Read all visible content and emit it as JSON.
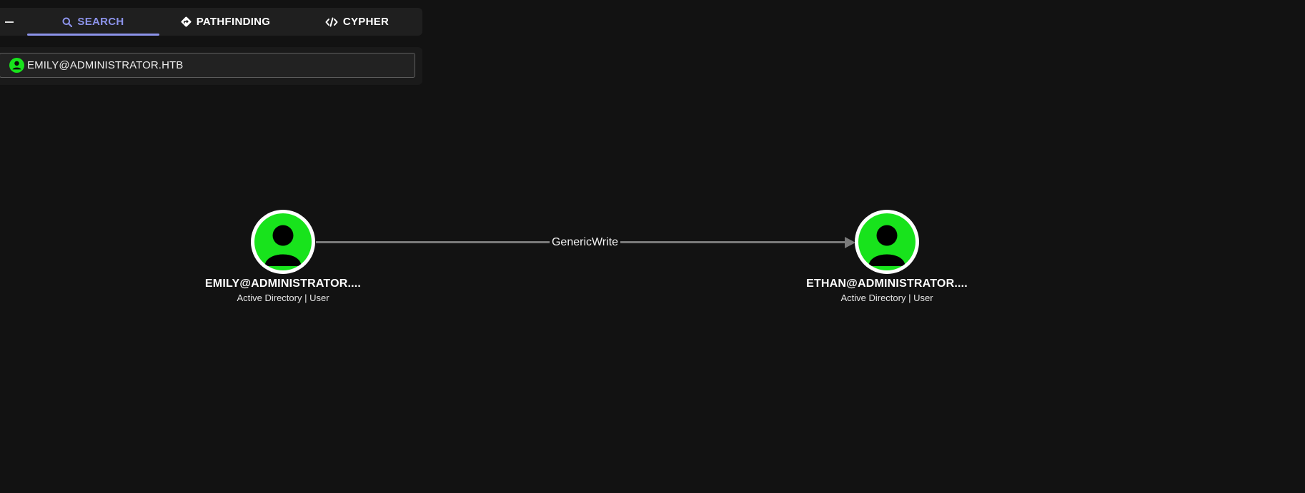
{
  "tabs": {
    "search": "SEARCH",
    "pathfinding": "PATHFINDING",
    "cypher": "CYPHER"
  },
  "search": {
    "value": "EMILY@ADMINISTRATOR.HTB"
  },
  "graph": {
    "edge_label": "GenericWrite",
    "nodes": [
      {
        "title": "EMILY@ADMINISTRATOR....",
        "subtitle": "Active Directory | User"
      },
      {
        "title": "ETHAN@ADMINISTRATOR....",
        "subtitle": "Active Directory | User"
      }
    ]
  },
  "colors": {
    "accent": "#8c93ea",
    "node_fill": "#18e31c",
    "background": "#121212"
  },
  "icons": {
    "search_tab": "search-icon",
    "pathfinding_tab": "directions-icon",
    "cypher_tab": "code-icon",
    "search_field": "user-icon",
    "node": "user-icon"
  }
}
